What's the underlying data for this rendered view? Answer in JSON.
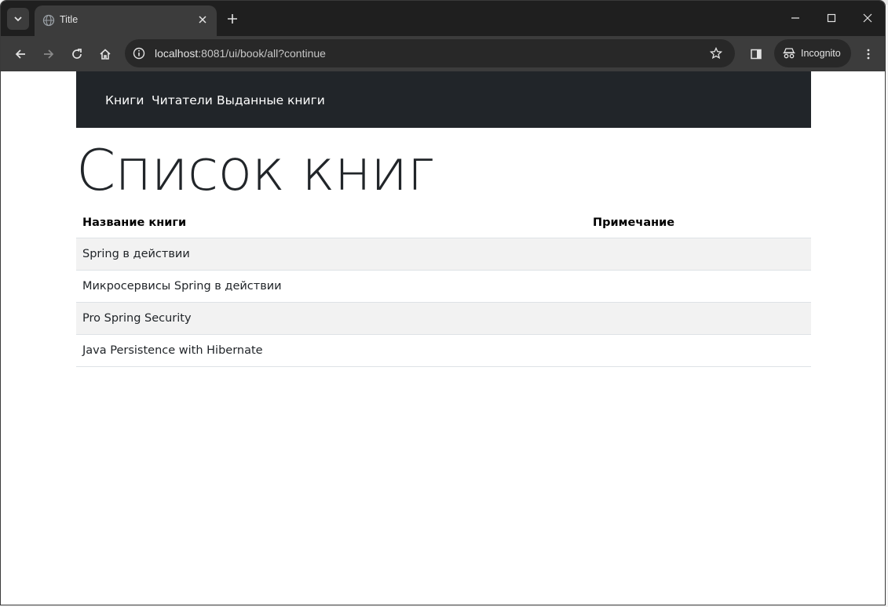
{
  "browser": {
    "tab_title": "Title",
    "url_host": "localhost",
    "url_rest": ":8081/ui/book/all?continue",
    "incognito_label": "Incognito"
  },
  "navbar": {
    "items": [
      {
        "label": "Книги"
      },
      {
        "label": "Читатели"
      },
      {
        "label": "Выданные книги"
      }
    ]
  },
  "page": {
    "title": "Список книг",
    "table": {
      "headers": [
        "Название книги",
        "Примечание"
      ],
      "rows": [
        [
          "Spring в действии",
          ""
        ],
        [
          "Микросервисы Spring в действии",
          ""
        ],
        [
          "Pro Spring Security",
          ""
        ],
        [
          "Java Persistence with Hibernate",
          ""
        ]
      ]
    }
  },
  "colors": {
    "navbar_bg": "#212529",
    "row_stripe": "#f2f2f2",
    "chrome_dark": "#1f1f1f",
    "chrome_toolbar": "#3c3c3c"
  },
  "icons": {
    "tab_search": "chevron-down-icon",
    "favicon": "globe-icon",
    "tab_close": "close-icon",
    "new_tab": "plus-icon",
    "back": "arrow-left-icon",
    "forward": "arrow-right-icon",
    "reload": "reload-icon",
    "home": "home-icon",
    "site_info": "info-icon",
    "bookmark": "star-icon",
    "side_panel": "side-panel-icon",
    "incognito": "incognito-icon",
    "menu": "kebab-menu-icon"
  }
}
